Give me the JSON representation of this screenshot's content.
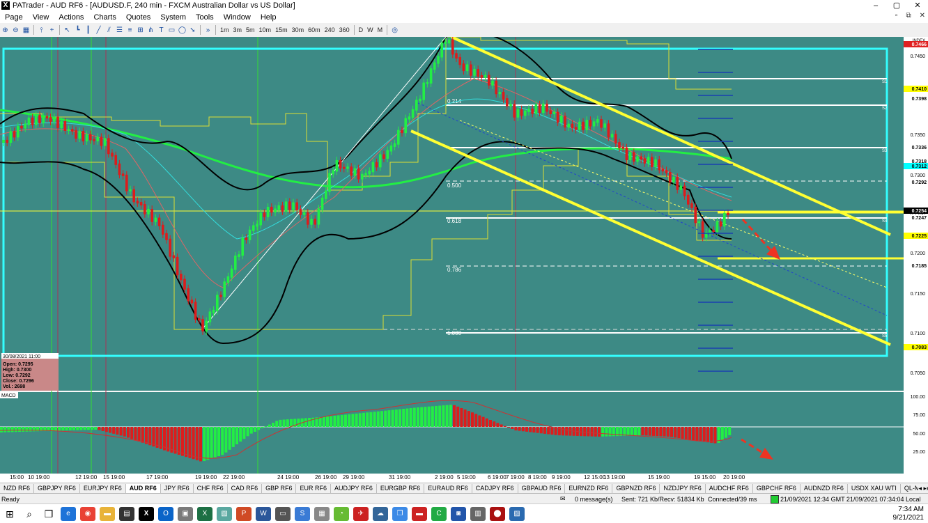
{
  "window": {
    "title": "PATrader - AUD RF6 - [AUDUSD.F, 240 min - FXCM Australian Dollar vs US Dollar]",
    "app_icon_glyph": "X",
    "controls": [
      "–",
      "▢",
      "✕"
    ]
  },
  "menu": {
    "items": [
      "Page",
      "View",
      "Actions",
      "Charts",
      "Quotes",
      "System",
      "Tools",
      "Window",
      "Help"
    ],
    "mdi_controls": [
      "▫",
      "⧉",
      "✕"
    ]
  },
  "toolbar": {
    "timeframes": [
      "1m",
      "3m",
      "5m",
      "10m",
      "15m",
      "30m",
      "60m",
      "240",
      "360",
      "D",
      "W",
      "M"
    ]
  },
  "chart": {
    "symbol_badge": "INDEX",
    "date_labels": [
      "15:00",
      "10 19:00",
      "12 19:00",
      "15 19:00",
      "17 19:00",
      "19 19:00",
      "22 19:00",
      "24 19:00",
      "26 19:00",
      "29 19:00",
      "31 19:00",
      "2 19:00",
      "5 19:00",
      "6 19:00",
      "7 19:00",
      "8 19:00",
      "9 19:00",
      "12 15:00",
      "13 19:00",
      "15 19:00",
      "19 15:00",
      "20 19:00"
    ],
    "price_labels": [
      "0.7450",
      "0.7350",
      "0.7300",
      "0.7250",
      "0.7200",
      "0.7150",
      "0.7100",
      "0.7050"
    ],
    "highlight_labels": [
      {
        "text": "0.7466",
        "bg": "#e02020",
        "fg": "#ffffff"
      },
      {
        "text": "0.7410",
        "bg": "#ffff00",
        "fg": "#000000"
      },
      {
        "text": "0.7398",
        "bg": "#ffffff",
        "fg": "#000000"
      },
      {
        "text": "0.7336",
        "bg": "#ffffff",
        "fg": "#000000"
      },
      {
        "text": "0.7318",
        "bg": "#ffffff",
        "fg": "#000000"
      },
      {
        "text": "0.7312",
        "bg": "#00ffff",
        "fg": "#000000"
      },
      {
        "text": "0.7292",
        "bg": "#ffffff",
        "fg": "#000000"
      },
      {
        "text": "0.7254",
        "bg": "#000000",
        "fg": "#ffffff"
      },
      {
        "text": "0.7247",
        "bg": "#ffffff",
        "fg": "#000000"
      },
      {
        "text": "0.7225",
        "bg": "#ffff00",
        "fg": "#000000"
      },
      {
        "text": "0.7185",
        "bg": "#ffffff",
        "fg": "#000000"
      },
      {
        "text": "0.7083",
        "bg": "#ffff00",
        "fg": "#000000"
      }
    ],
    "fib_labels": [
      "0.214",
      "0.500",
      "0.618",
      "0.786",
      "1.000"
    ],
    "level_tags": [
      "S1",
      "S2",
      "S3",
      "S4",
      "S5"
    ],
    "ohlc": {
      "date": "30/08/2021 11:00",
      "open": "Open: 0.7295",
      "high": "High: 0.7300",
      "low": "Low: 0.7292",
      "close": "Close: 0.7296",
      "vol": "Vol.: 2698"
    },
    "macd_label": "MACD",
    "macd_axis": [
      "100.00",
      "75.00",
      "50.00",
      "25.00"
    ],
    "colors": {
      "background": "#3d8a85",
      "bull": "#22ee44",
      "bear": "#dd1c1c",
      "channel": "#ffff33",
      "box": "#33ffff",
      "band": "#000000"
    }
  },
  "tabs": [
    "NZD RF6",
    "GBPJPY RF6",
    "EURJPY RF6",
    "AUD RF6",
    "JPY RF6",
    "CHF RF6",
    "CAD RF6",
    "GBP RF6",
    "EUR RF6",
    "AUDJPY RF6",
    "EURGBP RF6",
    "EURAUD RF6",
    "CADJPY RF6",
    "GBPAUD RF6",
    "EURNZD RF6",
    "GBPNZD RF6",
    "NZDJPY RF6",
    "AUDCHF RF6",
    "GBPCHF RF6",
    "AUDNZD RF6",
    "USDX XAU WTI",
    "QL-Majors",
    "QL-Exotics",
    "USDX RF6",
    "Bitcoin",
    "XRPUSDRF6"
  ],
  "active_tab": "AUD RF6",
  "status": {
    "ready": "Ready",
    "messages": "0 message(s)",
    "traffic": "Sent: 721 Kb/Recv: 51834 Kb",
    "connection": "Connected/39 ms",
    "times": "21/09/2021 12:34 GMT  21/09/2021 07:34:04 Local"
  },
  "taskbar": {
    "time": "7:34 AM",
    "date": "9/21/2021"
  }
}
